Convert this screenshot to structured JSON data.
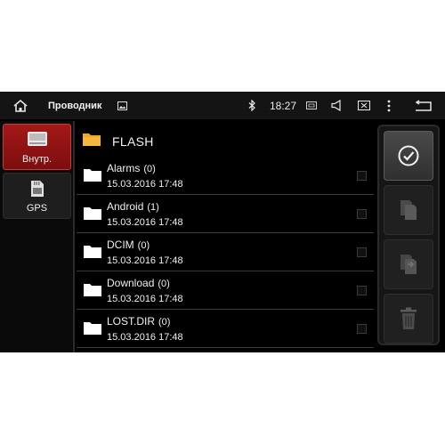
{
  "statusbar": {
    "title": "Проводник",
    "time": "18:27",
    "icons": [
      "home-icon",
      "image-icon",
      "bluetooth-icon",
      "screen-box-icon",
      "volume-icon",
      "screen-off-icon",
      "menu-icon",
      "back-icon"
    ]
  },
  "sidebar": {
    "items": [
      {
        "label": "Внутр.",
        "icon": "internal-storage-icon",
        "active": true
      },
      {
        "label": "GPS",
        "icon": "sd-card-icon",
        "active": false
      }
    ]
  },
  "path": {
    "label": "FLASH"
  },
  "files": [
    {
      "name": "Alarms",
      "count": "(0)",
      "date": "15.03.2016 17:48"
    },
    {
      "name": "Android",
      "count": "(1)",
      "date": "15.03.2016 17:48"
    },
    {
      "name": "DCIM",
      "count": "(0)",
      "date": "15.03.2016 17:48"
    },
    {
      "name": "Download",
      "count": "(0)",
      "date": "15.03.2016 17:48"
    },
    {
      "name": "LOST.DIR",
      "count": "(0)",
      "date": "15.03.2016 17:48"
    }
  ],
  "actions": [
    "select-all-icon",
    "copy-icon",
    "paste-icon",
    "trash-icon"
  ],
  "colors": {
    "accent": "#a41818",
    "background": "#000000",
    "statusbar": "#141414",
    "folder_path": "#f0a826",
    "folder": "#ffffff"
  }
}
